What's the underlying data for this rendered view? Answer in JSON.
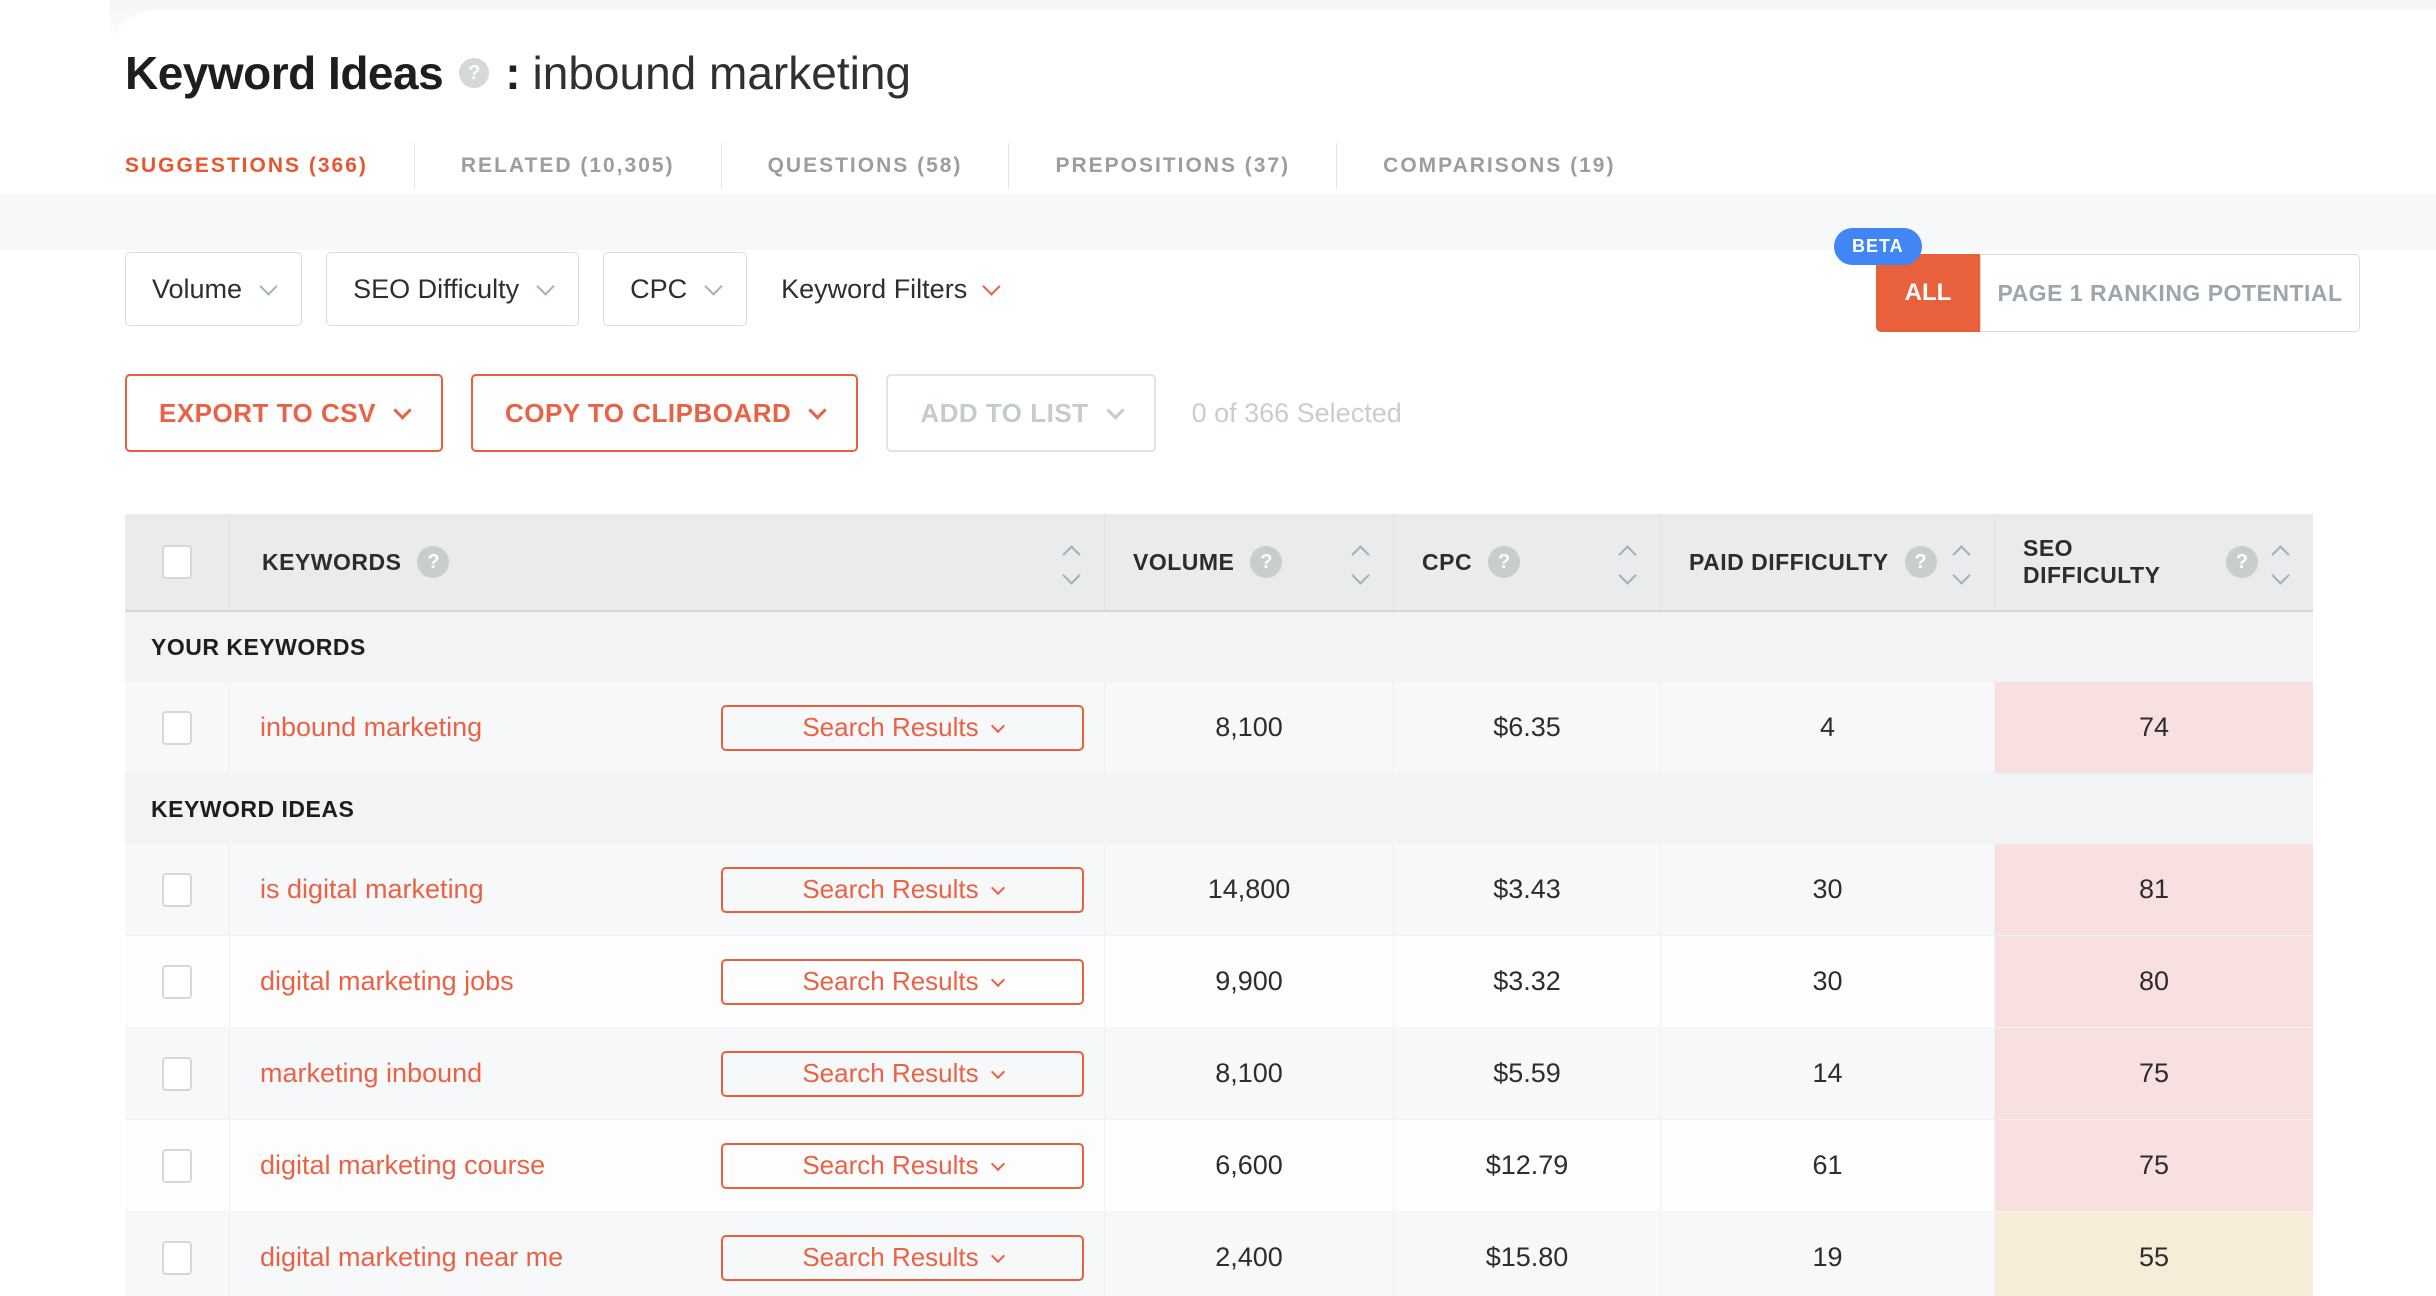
{
  "page_title": {
    "title": "Keyword Ideas",
    "colon": ":",
    "query": "inbound marketing",
    "help_icon": "?"
  },
  "tabs": [
    {
      "label": "SUGGESTIONS (366)",
      "active": true
    },
    {
      "label": "RELATED (10,305)",
      "active": false
    },
    {
      "label": "QUESTIONS (58)",
      "active": false
    },
    {
      "label": "PREPOSITIONS (37)",
      "active": false
    },
    {
      "label": "COMPARISONS (19)",
      "active": false
    }
  ],
  "filters": {
    "volume_label": "Volume",
    "seo_difficulty_label": "SEO Difficulty",
    "cpc_label": "CPC",
    "keyword_filters_label": "Keyword Filters"
  },
  "ranking_potential": {
    "beta_badge": "BETA",
    "all_label": "ALL",
    "page1_label": "PAGE 1 RANKING POTENTIAL"
  },
  "actions": {
    "export_csv_label": "EXPORT TO CSV",
    "copy_clipboard_label": "COPY TO CLIPBOARD",
    "add_to_list_label": "ADD TO LIST",
    "selection_status": "0 of 366 Selected"
  },
  "table": {
    "headers": {
      "keywords": "KEYWORDS",
      "volume": "VOLUME",
      "cpc": "CPC",
      "paid_difficulty": "PAID DIFFICULTY",
      "seo_difficulty": "SEO DIFFICULTY"
    },
    "search_results_label": "Search Results",
    "help_icon": "?",
    "sections": [
      {
        "label": "YOUR KEYWORDS",
        "rows": [
          {
            "keyword": "inbound marketing",
            "volume": "8,100",
            "cpc": "$6.35",
            "paid_difficulty": "4",
            "seo_difficulty": "74"
          }
        ]
      },
      {
        "label": "KEYWORD IDEAS",
        "rows": [
          {
            "keyword": "is digital marketing",
            "volume": "14,800",
            "cpc": "$3.43",
            "paid_difficulty": "30",
            "seo_difficulty": "81"
          },
          {
            "keyword": "digital marketing jobs",
            "volume": "9,900",
            "cpc": "$3.32",
            "paid_difficulty": "30",
            "seo_difficulty": "80"
          },
          {
            "keyword": "marketing inbound",
            "volume": "8,100",
            "cpc": "$5.59",
            "paid_difficulty": "14",
            "seo_difficulty": "75"
          },
          {
            "keyword": "digital marketing course",
            "volume": "6,600",
            "cpc": "$12.79",
            "paid_difficulty": "61",
            "seo_difficulty": "75"
          },
          {
            "keyword": "digital marketing near me",
            "volume": "2,400",
            "cpc": "$15.80",
            "paid_difficulty": "19",
            "seo_difficulty": "55"
          }
        ]
      }
    ]
  },
  "colors": {
    "accent_orange": "#e8603c",
    "beta_blue": "#4285f4",
    "seo_hard_bg": "#f8e0e1",
    "seo_medium_bg": "#f6ecd8"
  }
}
